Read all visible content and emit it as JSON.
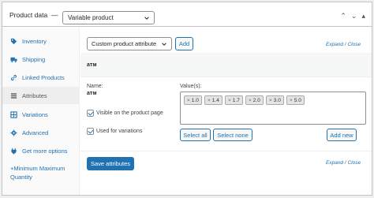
{
  "header": {
    "title": "Product data",
    "dash": "—",
    "product_type": "Variable product",
    "icons": [
      "chevron-up-icon",
      "chevron-down-icon",
      "collapse-icon"
    ]
  },
  "sidebar": {
    "items": [
      {
        "label": "Inventory",
        "icon": "tag-icon"
      },
      {
        "label": "Shipping",
        "icon": "truck-icon"
      },
      {
        "label": "Linked Products",
        "icon": "link-icon"
      },
      {
        "label": "Attributes",
        "icon": "list-icon",
        "active": true
      },
      {
        "label": "Variations",
        "icon": "grid-icon"
      },
      {
        "label": "Advanced",
        "icon": "gear-icon"
      },
      {
        "label": "Get more options",
        "icon": "plugin-icon"
      },
      {
        "label": "+Minimum Maximum Quantity",
        "label_line1": "+Minimum Maximum",
        "label_line2": "Quantity",
        "icon": ""
      }
    ]
  },
  "toolbar": {
    "attribute_select": "Custom product attribute",
    "add_label": "Add",
    "expand": "Expand",
    "close": "Close",
    "sep": "/"
  },
  "attribute": {
    "heading": "атм",
    "name_label": "Name:",
    "name_value": "атм",
    "values_label": "Value(s):",
    "values": [
      "1.0",
      "1.4",
      "1.7",
      "2.0",
      "3.0",
      "5.0"
    ],
    "visible_label": "Visible on the product page",
    "variations_label": "Used for variations",
    "select_all": "Select all",
    "select_none": "Select none",
    "add_new": "Add new"
  },
  "footer": {
    "save_label": "Save attributes",
    "expand": "Expand",
    "close": "Close",
    "sep": "/"
  },
  "colors": {
    "accent": "#2271b1",
    "border": "#c3c4c7",
    "active_bg": "#eeeeee"
  }
}
